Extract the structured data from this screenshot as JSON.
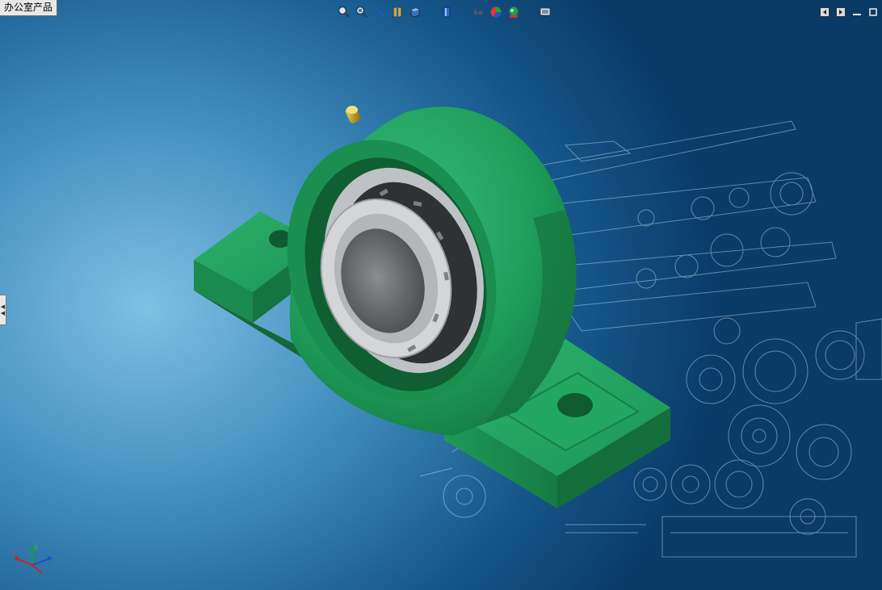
{
  "window": {
    "tab_label": "办公室产品"
  },
  "toolbar": {
    "buttons": [
      {
        "name": "zoom-to-fit-icon"
      },
      {
        "name": "zoom-to-area-icon"
      },
      {
        "name": "previous-view-icon"
      },
      {
        "name": "section-view-icon"
      },
      {
        "name": "view-orientation-icon"
      },
      {
        "name": "display-style-icon"
      },
      {
        "name": "hide-show-items-icon"
      },
      {
        "name": "edit-appearance-icon"
      },
      {
        "name": "apply-scene-icon"
      },
      {
        "name": "view-settings-icon"
      }
    ]
  },
  "colors": {
    "background_light": "#7fc0e2",
    "background_dark": "#0a3a66",
    "housing_green": "#1e9a57",
    "bearing_grey": "#c9cbcd",
    "grease_fitting_gold": "#d4b02a"
  },
  "triad": {
    "axes": [
      "x",
      "y",
      "z"
    ]
  }
}
